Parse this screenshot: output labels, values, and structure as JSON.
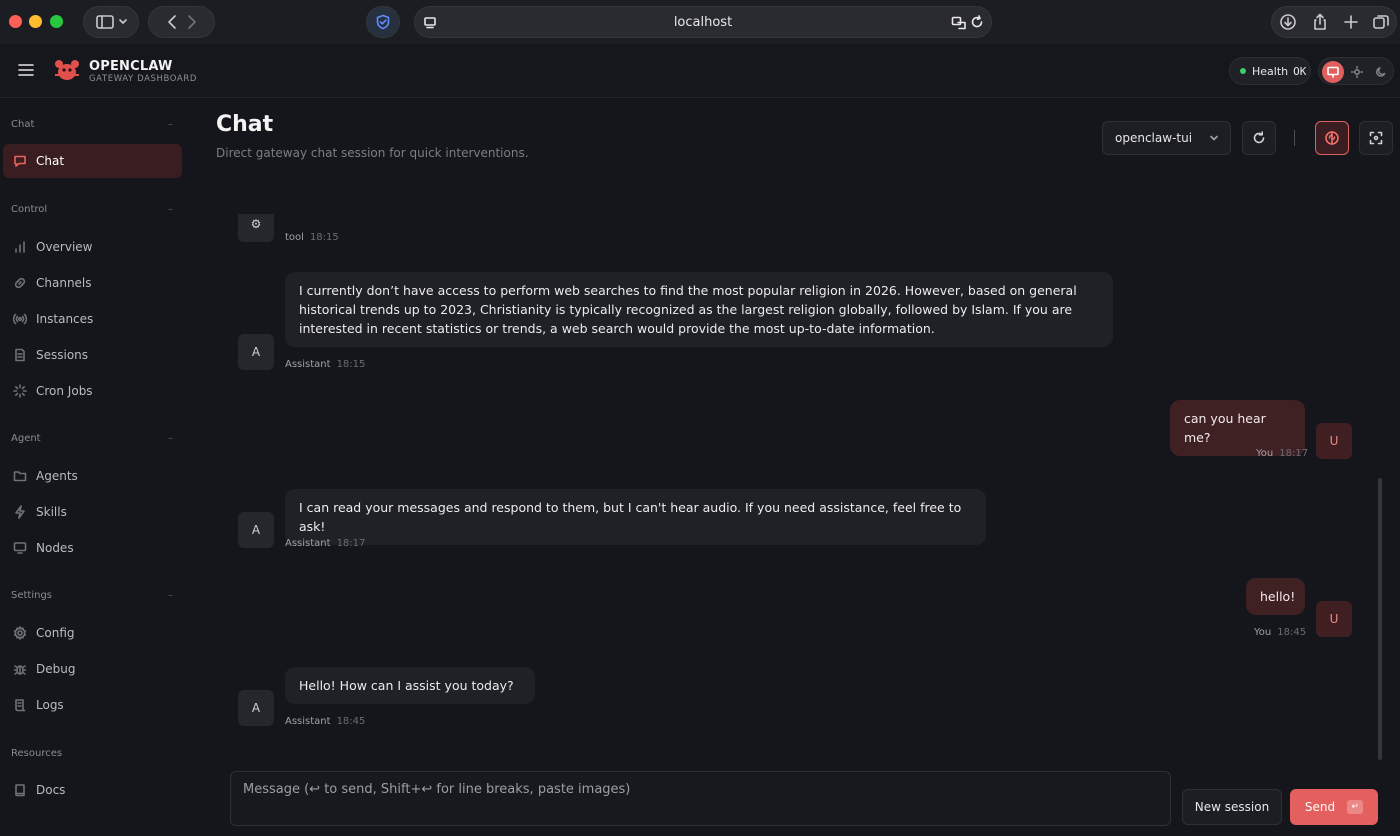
{
  "browser": {
    "url": "localhost"
  },
  "brand": {
    "title": "OPENCLAW",
    "subtitle": "GATEWAY DASHBOARD"
  },
  "header": {
    "health_label": "Health",
    "health_status": "OK",
    "health_color": "#3ccf6a",
    "accent_color": "#e4605e"
  },
  "sidebar": {
    "sections": [
      {
        "label": "Chat",
        "items": [
          {
            "label": "Chat",
            "icon": "message-icon",
            "active": true
          }
        ]
      },
      {
        "label": "Control",
        "items": [
          {
            "label": "Overview",
            "icon": "bar-chart-icon"
          },
          {
            "label": "Channels",
            "icon": "link-icon"
          },
          {
            "label": "Instances",
            "icon": "radio-icon"
          },
          {
            "label": "Sessions",
            "icon": "document-icon"
          },
          {
            "label": "Cron Jobs",
            "icon": "loader-icon"
          }
        ]
      },
      {
        "label": "Agent",
        "items": [
          {
            "label": "Agents",
            "icon": "folder-icon"
          },
          {
            "label": "Skills",
            "icon": "bolt-icon"
          },
          {
            "label": "Nodes",
            "icon": "monitor-icon"
          }
        ]
      },
      {
        "label": "Settings",
        "items": [
          {
            "label": "Config",
            "icon": "gear-icon"
          },
          {
            "label": "Debug",
            "icon": "bug-icon"
          },
          {
            "label": "Logs",
            "icon": "scroll-icon"
          }
        ]
      },
      {
        "label": "Resources",
        "items": [
          {
            "label": "Docs",
            "icon": "book-icon"
          }
        ]
      }
    ],
    "collapse_marker": "–"
  },
  "main": {
    "title": "Chat",
    "subtitle": "Direct gateway chat session for quick interventions.",
    "session_selected": "openclaw-tui"
  },
  "messages": [
    {
      "role": "tool",
      "sender": "tool",
      "time": "18:15",
      "avatar": "⚙"
    },
    {
      "role": "assistant",
      "sender": "Assistant",
      "time": "18:15",
      "avatar": "A",
      "text": "I currently don’t have access to perform web searches to find the most popular religion in 2026. However, based on general historical trends up to 2023, Christianity is typically recognized as the largest religion globally, followed by Islam. If you are interested in recent statistics or trends, a web search would provide the most up-to-date information."
    },
    {
      "role": "user",
      "sender": "You",
      "time": "18:17",
      "avatar": "U",
      "text": "can you hear me?"
    },
    {
      "role": "assistant",
      "sender": "Assistant",
      "time": "18:17",
      "avatar": "A",
      "text": "I can read your messages and respond to them, but I can't hear audio. If you need assistance, feel free to ask!"
    },
    {
      "role": "user",
      "sender": "You",
      "time": "18:45",
      "avatar": "U",
      "text": "hello!"
    },
    {
      "role": "assistant",
      "sender": "Assistant",
      "time": "18:45",
      "avatar": "A",
      "text": "Hello! How can I assist you today?"
    }
  ],
  "composer": {
    "placeholder": "Message (↩ to send, Shift+↩ for line breaks, paste images)",
    "new_session_label": "New session",
    "send_label": "Send",
    "send_key": "↵"
  }
}
